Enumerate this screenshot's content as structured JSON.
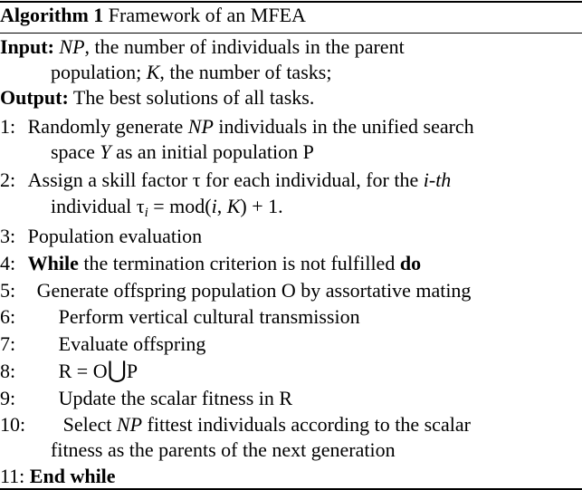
{
  "algorithm": {
    "caption_label": "Algorithm 1",
    "caption_text": "Framework of an MFEA",
    "input_label": "Input:",
    "input_np": "NP",
    "input_part1": ", the number of individuals in the parent",
    "input_part2": "population; ",
    "input_k": "K",
    "input_part3": ", the number of tasks;",
    "output_label": "Output:",
    "output_text": "The best solutions of all tasks.",
    "steps": {
      "s1": {
        "num": "1:",
        "a": "Randomly generate ",
        "np": "NP",
        "b": " individuals in the unified search",
        "c": "space ",
        "y": "Y",
        "d": " as an initial population P"
      },
      "s2": {
        "num": "2:",
        "a": "Assign a skill factor τ for each individual, for the ",
        "ith": "i-th",
        "b": "individual τ",
        "sub": "i",
        "c": " = mod(",
        "i": "i",
        "comma": ", ",
        "k": "K",
        "d": ") + 1."
      },
      "s3": {
        "num": "3:",
        "text": "Population evaluation"
      },
      "s4": {
        "num": "4:",
        "while": "While",
        "text": " the termination criterion is not fulfilled ",
        "do": "do"
      },
      "s5": {
        "num": "5:",
        "text": "Generate offspring population O by assortative mating"
      },
      "s6": {
        "num": "6:",
        "text": "Perform vertical cultural transmission"
      },
      "s7": {
        "num": "7:",
        "text": "Evaluate offspring"
      },
      "s8": {
        "num": "8:",
        "a": "R = O",
        "cup": "⋃",
        "b": "P"
      },
      "s9": {
        "num": "9:",
        "text": "Update the scalar fitness in R"
      },
      "s10": {
        "num": "10:",
        "a": "Select ",
        "np": "NP",
        "b": " fittest individuals according to the scalar",
        "c": "fitness as the parents of the next generation"
      },
      "s11": {
        "num": "11:",
        "text": "End while"
      }
    }
  }
}
